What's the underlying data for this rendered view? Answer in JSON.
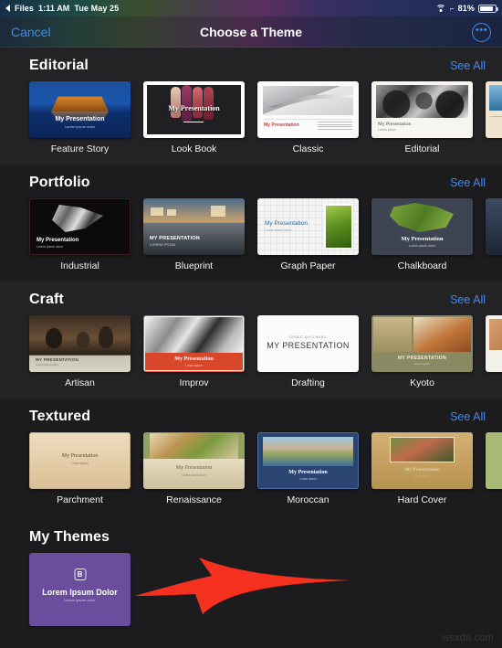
{
  "statusbar": {
    "back_app": "Files",
    "time": "1:11 AM",
    "date": "Tue May 25",
    "battery_percent": "81%",
    "wifi_icon": "wifi-icon",
    "location_icon": "location-arrow-icon",
    "battery_icon": "battery-icon"
  },
  "navbar": {
    "cancel_label": "Cancel",
    "title": "Choose a Theme",
    "more_label": "•••",
    "more_icon": "ellipsis-circle-icon",
    "accent_color": "#3d8bf2"
  },
  "sections": [
    {
      "title": "Editorial",
      "see_all_label": "See All",
      "themes": [
        {
          "name": "Feature Story",
          "slide_title": "My Presentation",
          "slide_sub": "Lorem ipsum dolor"
        },
        {
          "name": "Look Book",
          "slide_title": "My Presentation",
          "slide_sub": ""
        },
        {
          "name": "Classic",
          "slide_title": "My Presentation",
          "slide_sub": ""
        },
        {
          "name": "Editorial",
          "slide_title": "My Presentation",
          "slide_sub": "Lorem ipsum"
        }
      ]
    },
    {
      "title": "Portfolio",
      "see_all_label": "See All",
      "themes": [
        {
          "name": "Industrial",
          "slide_title": "My Presentation",
          "slide_sub": "Lorem ipsum dolor"
        },
        {
          "name": "Blueprint",
          "slide_title": "MY PRESENTATION",
          "slide_sub": "LOREM IPSUM"
        },
        {
          "name": "Graph Paper",
          "slide_title": "My Presentation",
          "slide_sub": "Lorem ipsum dolor"
        },
        {
          "name": "Chalkboard",
          "slide_title": "My Presentation",
          "slide_sub": "Lorem ipsum dolor"
        }
      ]
    },
    {
      "title": "Craft",
      "see_all_label": "See All",
      "themes": [
        {
          "name": "Artisan",
          "slide_title": "MY PRESENTATION",
          "slide_sub": "Lorem ipsum dolor"
        },
        {
          "name": "Improv",
          "slide_title": "My Presentation",
          "slide_sub": "Lorem ipsum"
        },
        {
          "name": "Drafting",
          "slide_title": "MY PRESENTATION",
          "slide_sub": "DONEC QUIS NUNC"
        },
        {
          "name": "Kyoto",
          "slide_title": "MY PRESENTATION",
          "slide_sub": "Lorem ipsum"
        }
      ]
    },
    {
      "title": "Textured",
      "see_all_label": "See All",
      "themes": [
        {
          "name": "Parchment",
          "slide_title": "My Presentation",
          "slide_sub": "Lorem ipsum"
        },
        {
          "name": "Renaissance",
          "slide_title": "My Presentation",
          "slide_sub": "Lorem ipsum dolor"
        },
        {
          "name": "Moroccan",
          "slide_title": "My Presentation",
          "slide_sub": "Lorem ipsum"
        },
        {
          "name": "Hard Cover",
          "slide_title": "My Presentation",
          "slide_sub": "Lorem ipsum"
        }
      ]
    }
  ],
  "my_themes": {
    "title": "My Themes",
    "card": {
      "badge": "B",
      "title": "Lorem Ipsum Dolor",
      "subtitle": "Lorem ipsum dolor",
      "color": "#6b4d9e"
    }
  },
  "annotation": {
    "arrow_color": "#f5301e",
    "arrow_direction": "left"
  },
  "watermark": "wsxdn.com"
}
